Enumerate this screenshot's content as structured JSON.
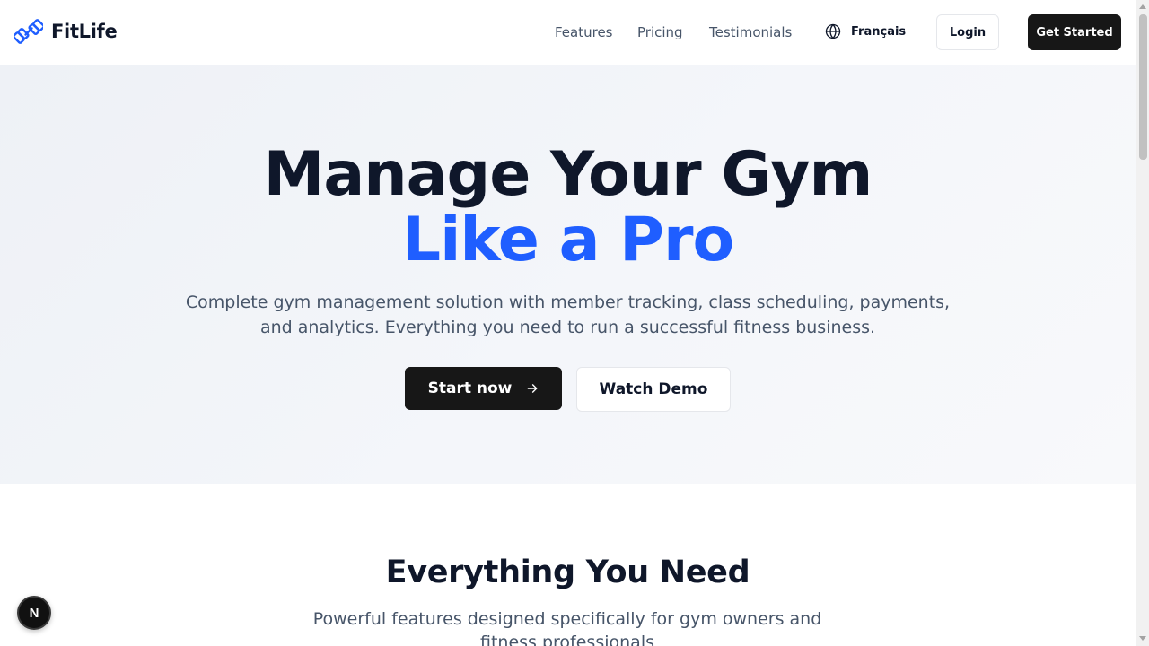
{
  "header": {
    "brand": "FitLife",
    "nav": [
      "Features",
      "Pricing",
      "Testimonials"
    ],
    "language": "Français",
    "login_label": "Login",
    "get_started_label": "Get Started"
  },
  "hero": {
    "title_line1": "Manage Your Gym",
    "title_line2": "Like a Pro",
    "subtitle": "Complete gym management solution with member tracking, class scheduling, payments, and analytics. Everything you need to run a successful fitness business.",
    "start_label": "Start now",
    "demo_label": "Watch Demo"
  },
  "features": {
    "title": "Everything You Need",
    "subtitle": "Powerful features designed specifically for gym owners and fitness professionals"
  },
  "dev_badge": "N",
  "icons": {
    "logo": "dumbbell-icon",
    "language": "globe-icon",
    "start": "arrow-right-icon"
  },
  "colors": {
    "accent": "#1f5eff",
    "primary_button": "#171717",
    "heading": "#0f172a",
    "muted_text": "#475569"
  }
}
